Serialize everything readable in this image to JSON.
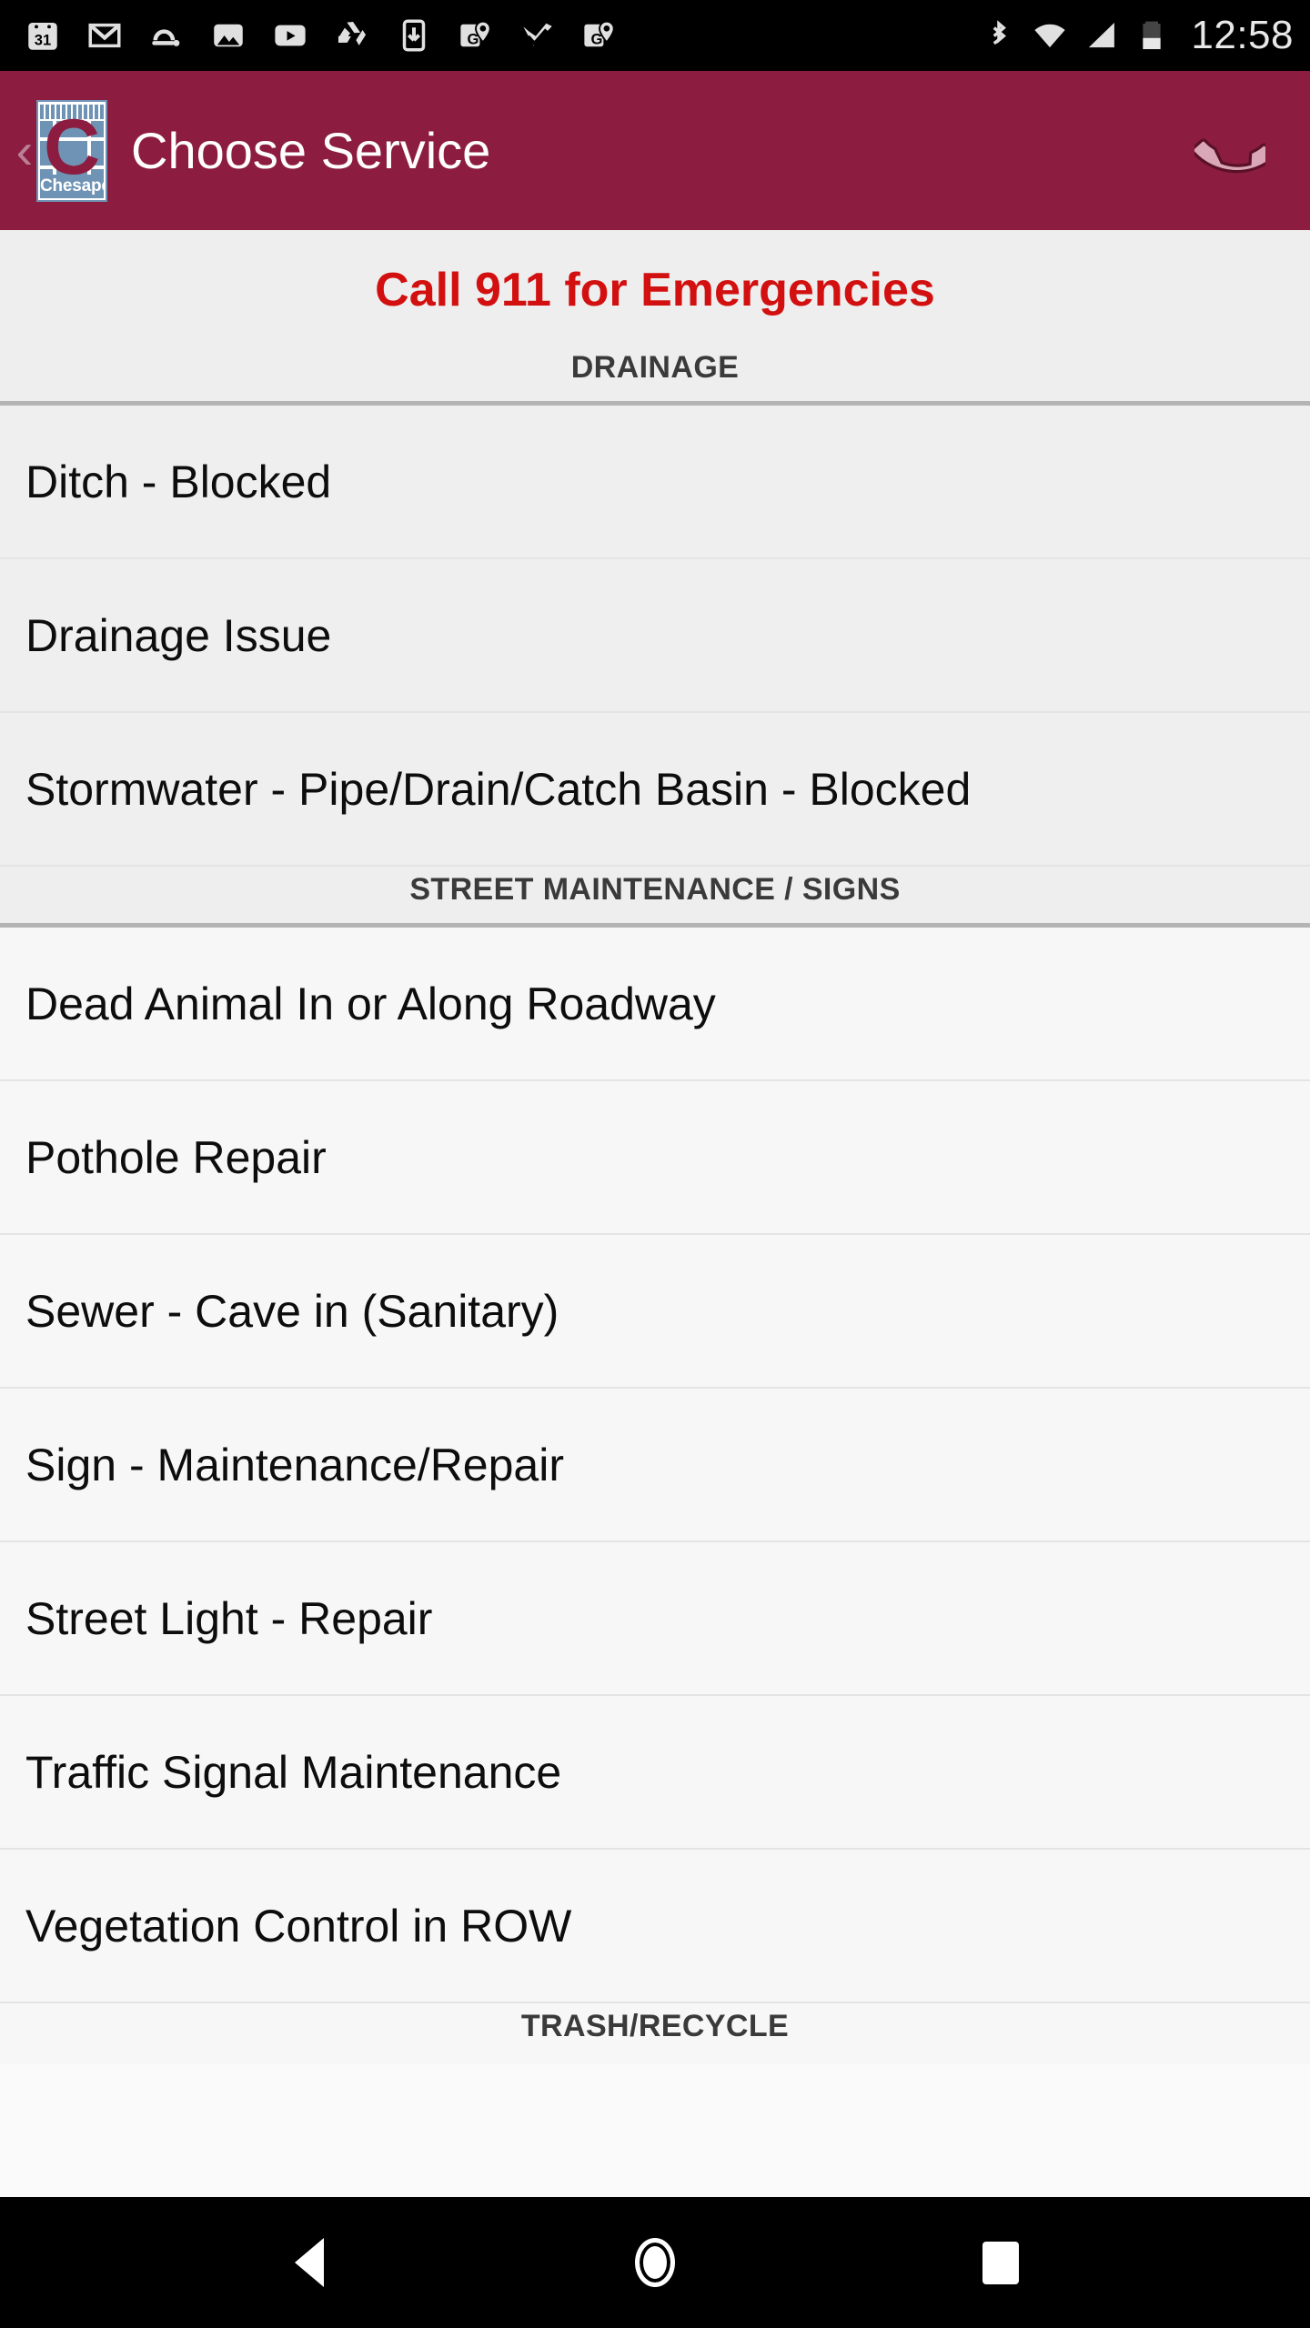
{
  "status_bar": {
    "time": "12:58",
    "notification_icons": [
      "calendar-31-icon",
      "gmail-icon",
      "google-fit-icon",
      "photos-icon",
      "youtube-icon",
      "drive-icon",
      "download-icon",
      "maps-pin-icon",
      "tasks-check-icon",
      "maps-pin-icon-2"
    ],
    "system_icons": [
      "bluetooth-icon",
      "wifi-icon",
      "cell-signal-icon",
      "battery-icon"
    ],
    "battery_level_percent": 40
  },
  "app_bar": {
    "back_label": "‹",
    "title": "Choose Service",
    "logo": {
      "letter": "C",
      "city_name": "Chesapeake"
    },
    "call_action": "phone-icon",
    "background_color": "#8c1d40"
  },
  "content": {
    "emergency_notice": "Call 911 for Emergencies",
    "emergency_color": "#d31010",
    "sections": [
      {
        "header": "DRAINAGE",
        "items": [
          {
            "label": "Ditch - Blocked"
          },
          {
            "label": "Drainage Issue"
          },
          {
            "label": "Stormwater -  Pipe/Drain/Catch Basin - Blocked"
          }
        ]
      },
      {
        "header": "STREET MAINTENANCE / SIGNS",
        "items": [
          {
            "label": "Dead Animal In or Along Roadway"
          },
          {
            "label": "Pothole Repair"
          },
          {
            "label": "Sewer - Cave in (Sanitary)"
          },
          {
            "label": "Sign - Maintenance/Repair"
          },
          {
            "label": "Street Light - Repair"
          },
          {
            "label": "Traffic Signal Maintenance"
          },
          {
            "label": "Vegetation Control in ROW"
          }
        ]
      },
      {
        "header": "TRASH/RECYCLE",
        "items": []
      }
    ]
  },
  "nav_bar": {
    "buttons": [
      "back-nav-icon",
      "home-nav-icon",
      "recents-nav-icon"
    ]
  }
}
